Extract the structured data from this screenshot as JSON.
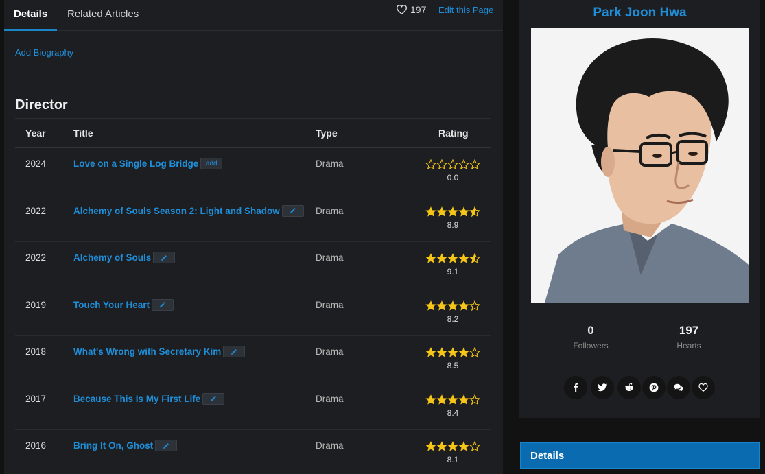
{
  "tabs": [
    {
      "label": "Details",
      "active": true
    },
    {
      "label": "Related Articles",
      "active": false
    }
  ],
  "page_actions": {
    "hearts_count": "197",
    "edit_label": "Edit this Page"
  },
  "biography": {
    "add_label": "Add Biography"
  },
  "director_section": {
    "title": "Director",
    "columns": [
      "Year",
      "Title",
      "Type",
      "Rating"
    ],
    "rows": [
      {
        "year": "2024",
        "title": "Love on a Single Log Bridge",
        "badge": "add",
        "type": "Drama",
        "rating": "0.0",
        "stars": 0.0
      },
      {
        "year": "2022",
        "title": "Alchemy of Souls Season 2: Light and Shadow",
        "badge": "edit",
        "type": "Drama",
        "rating": "8.9",
        "stars": 4.5
      },
      {
        "year": "2022",
        "title": "Alchemy of Souls",
        "badge": "edit",
        "type": "Drama",
        "rating": "9.1",
        "stars": 4.5
      },
      {
        "year": "2019",
        "title": "Touch Your Heart",
        "badge": "edit",
        "type": "Drama",
        "rating": "8.2",
        "stars": 4.0
      },
      {
        "year": "2018",
        "title": "What's Wrong with Secretary Kim",
        "badge": "edit",
        "type": "Drama",
        "rating": "8.5",
        "stars": 4.0
      },
      {
        "year": "2017",
        "title": "Because This Is My First Life",
        "badge": "edit",
        "type": "Drama",
        "rating": "8.4",
        "stars": 4.0
      },
      {
        "year": "2016",
        "title": "Bring It On, Ghost",
        "badge": "edit",
        "type": "Drama",
        "rating": "8.1",
        "stars": 4.0
      }
    ]
  },
  "profile": {
    "name": "Park Joon Hwa",
    "followers_count": "0",
    "followers_label": "Followers",
    "hearts_count": "197",
    "hearts_label": "Hearts",
    "share_icons": [
      "facebook-icon",
      "twitter-icon",
      "reddit-icon",
      "pinterest-icon",
      "comments-icon",
      "heart-icon"
    ]
  },
  "details_header": {
    "label": "Details"
  },
  "colors": {
    "accent": "#1f8ed8",
    "star": "#f5c518",
    "details_bar": "#0a6bb0",
    "panel": "#1d1e21"
  }
}
